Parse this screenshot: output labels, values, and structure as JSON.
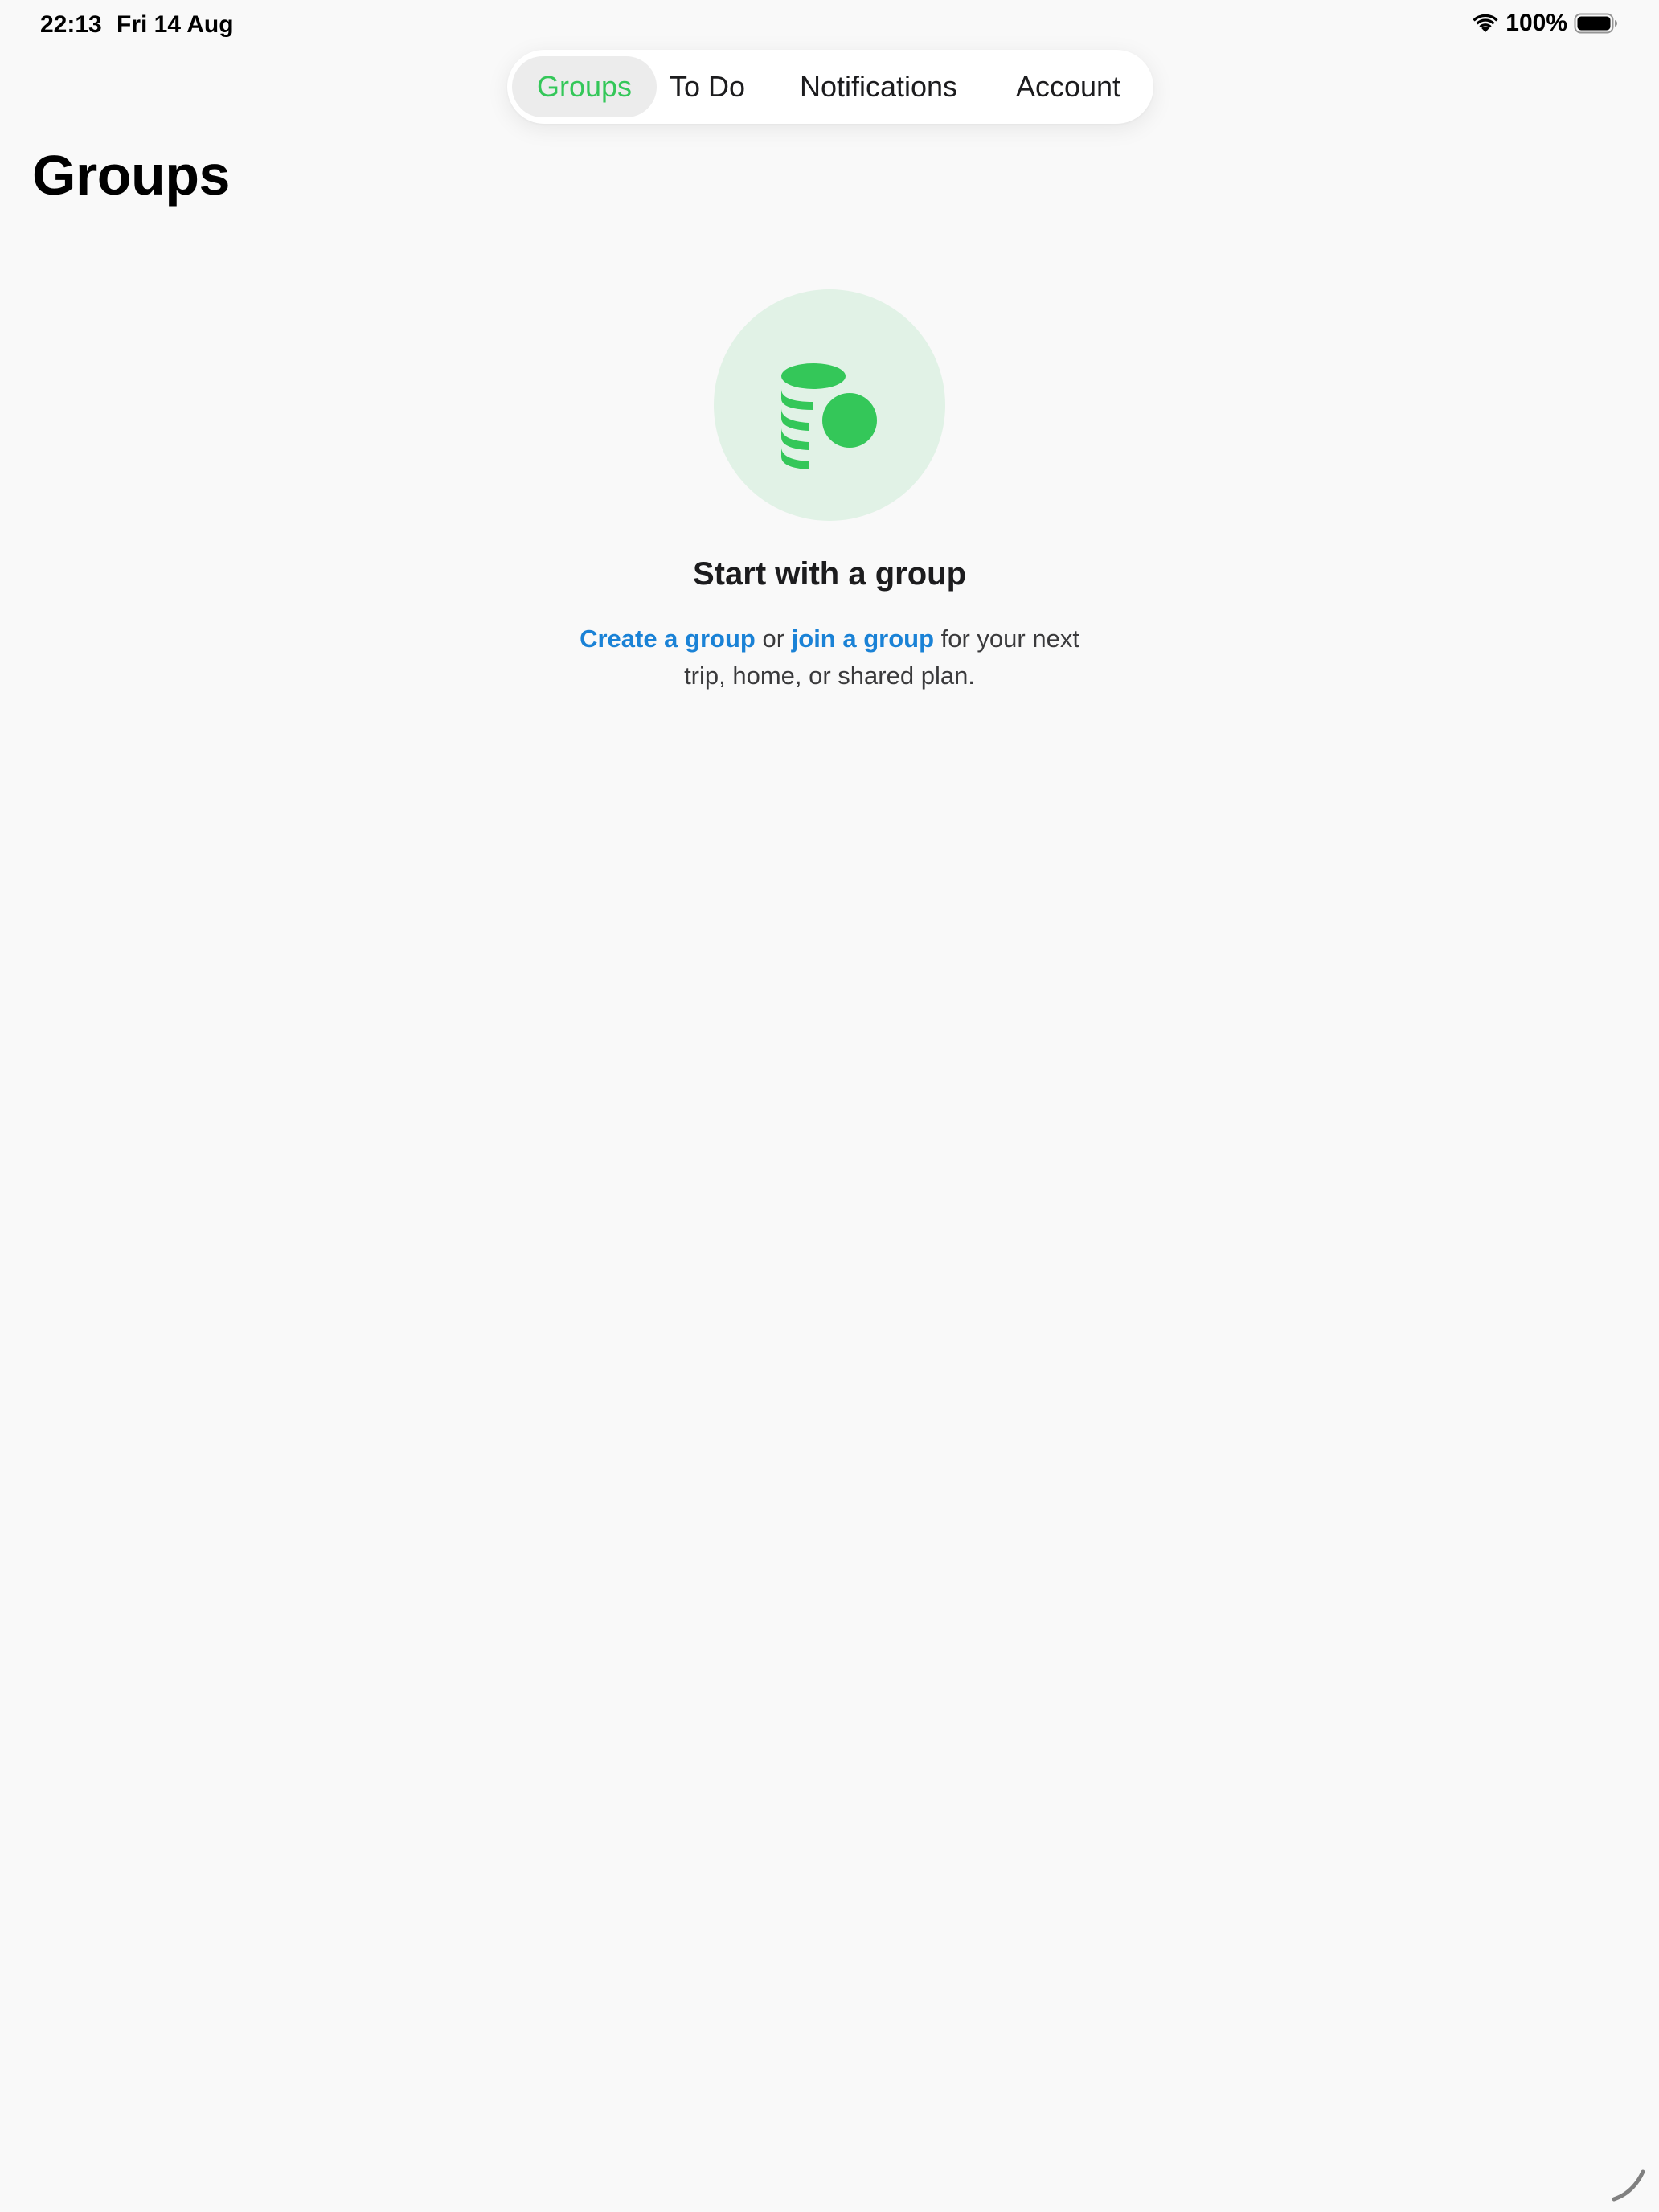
{
  "status_bar": {
    "time": "22:13",
    "date": "Fri 14 Aug",
    "battery_percent": "100%",
    "wifi_icon": "wifi-icon",
    "battery_icon": "battery-full-icon"
  },
  "tabs": [
    {
      "label": "Groups",
      "active": true
    },
    {
      "label": "To Do",
      "active": false
    },
    {
      "label": "Notifications",
      "active": false
    },
    {
      "label": "Account",
      "active": false
    }
  ],
  "page": {
    "title": "Groups"
  },
  "empty_state": {
    "icon": "coins-icon",
    "title": "Start with a group",
    "create_link": "Create a group",
    "or_text": " or ",
    "join_link": "join a group",
    "body_suffix": " for your next trip, home, or shared plan."
  },
  "colors": {
    "accent_green": "#34c759",
    "link_blue": "#1a82d6",
    "icon_bg": "#e1f2e6",
    "background": "#f9f9f9"
  }
}
